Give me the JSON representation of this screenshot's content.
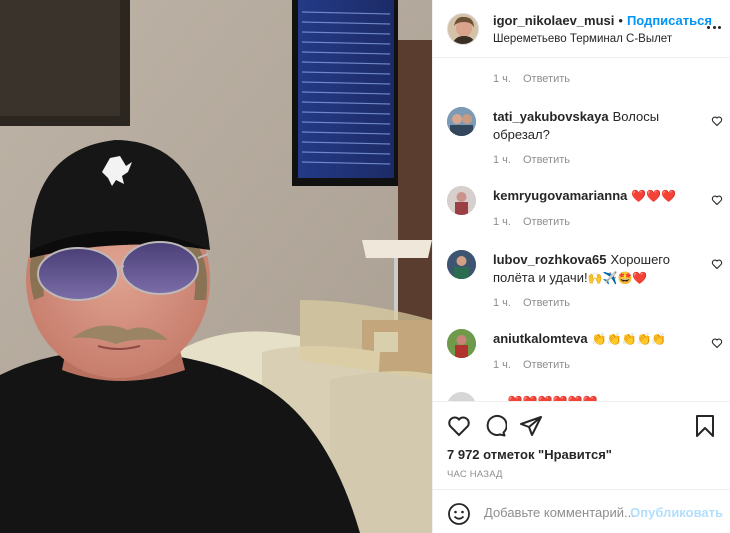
{
  "header": {
    "username": "igor_nikolaev_musi",
    "dot": "•",
    "follow_label": "Подписаться",
    "location": "Шереметьево Терминал С-Вылет"
  },
  "top_meta": {
    "time": "1 ч.",
    "reply": "Ответить"
  },
  "comments": [
    {
      "user": "tati_yakubovskaya",
      "text": "Волосы обрезал?",
      "time": "1 ч.",
      "reply": "Ответить"
    },
    {
      "user": "kemryugovamarianna",
      "emoji": "❤️❤️❤️",
      "time": "1 ч.",
      "reply": "Ответить"
    },
    {
      "user": "lubov_rozhkova65",
      "text": "Хорошего полёта и удачи!",
      "emoji": "🙌✈️🤩❤️",
      "time": "1 ч.",
      "reply": "Ответить"
    },
    {
      "user": "aniutkalomteva",
      "emoji": "👏👏👏👏👏",
      "time": "1 ч.",
      "reply": "Ответить"
    }
  ],
  "partial_comment": {
    "user": "...",
    "emoji": "❤️❤️❤️❤️❤️❤️"
  },
  "likes_text": "7 972 отметок \"Нравится\"",
  "timestamp": "ЧАС НАЗАД",
  "add_comment": {
    "placeholder": "Добавьте комментарий...",
    "post_label": "Опубликовать"
  },
  "icons": {
    "like": "heart-icon",
    "comment": "comment-icon",
    "share": "paper-plane-icon",
    "save": "bookmark-icon",
    "emoji": "smiley-icon",
    "more": "ellipsis-icon"
  },
  "colors": {
    "link_blue": "#0095f6",
    "muted": "#8e8e8e",
    "text": "#262626",
    "post_disabled": "#b2dffc"
  }
}
